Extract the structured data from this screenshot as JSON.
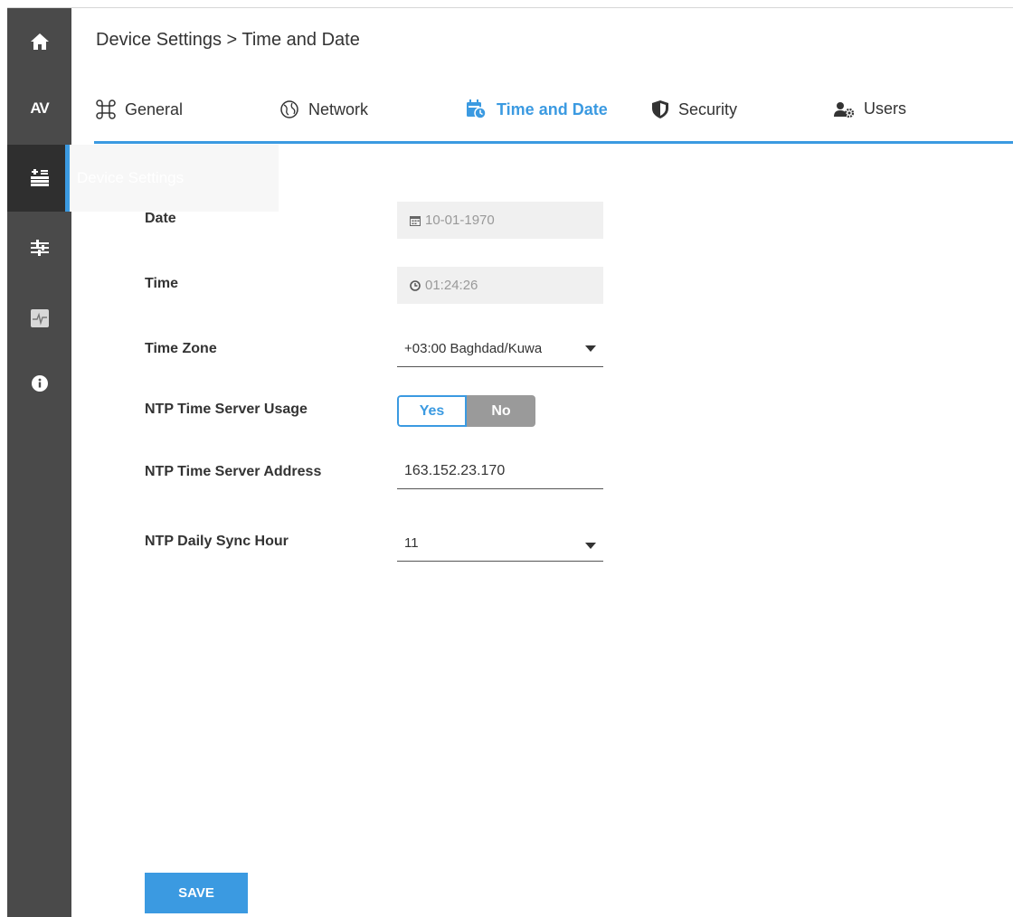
{
  "breadcrumb": "Device Settings > Time and Date",
  "sidebar": {
    "items": [
      {
        "name": "home",
        "icon": "home-icon"
      },
      {
        "name": "av",
        "label": "AV"
      },
      {
        "name": "device-settings",
        "icon": "device-settings-icon",
        "active": true,
        "flyout_label": "Device Settings"
      },
      {
        "name": "controls",
        "icon": "sliders-icon"
      },
      {
        "name": "diagnostics",
        "icon": "pulse-icon"
      },
      {
        "name": "info",
        "icon": "info-icon"
      }
    ]
  },
  "tabs": [
    {
      "label": "General",
      "icon": "command-icon"
    },
    {
      "label": "Network",
      "icon": "globe-icon"
    },
    {
      "label": "Time and Date",
      "icon": "calendar-clock-icon",
      "active": true
    },
    {
      "label": "Security",
      "icon": "shield-icon"
    },
    {
      "label": "Users",
      "icon": "users-gear-icon"
    }
  ],
  "form": {
    "date": {
      "label": "Date",
      "value": "10-01-1970"
    },
    "time": {
      "label": "Time",
      "value": "01:24:26"
    },
    "time_zone": {
      "label": "Time Zone",
      "value": "+03:00 Baghdad/Kuwa"
    },
    "ntp_usage": {
      "label": "NTP Time Server Usage",
      "yes": "Yes",
      "no": "No",
      "selected": "Yes"
    },
    "ntp_address": {
      "label": "NTP Time Server Address",
      "value": "163.152.23.170"
    },
    "ntp_sync_hour": {
      "label": "NTP Daily Sync Hour",
      "value": "11"
    }
  },
  "save_label": "SAVE",
  "colors": {
    "accent": "#3b9ae1",
    "sidebar": "#4a4a4a",
    "sidebar_active": "#2f2f2f"
  }
}
